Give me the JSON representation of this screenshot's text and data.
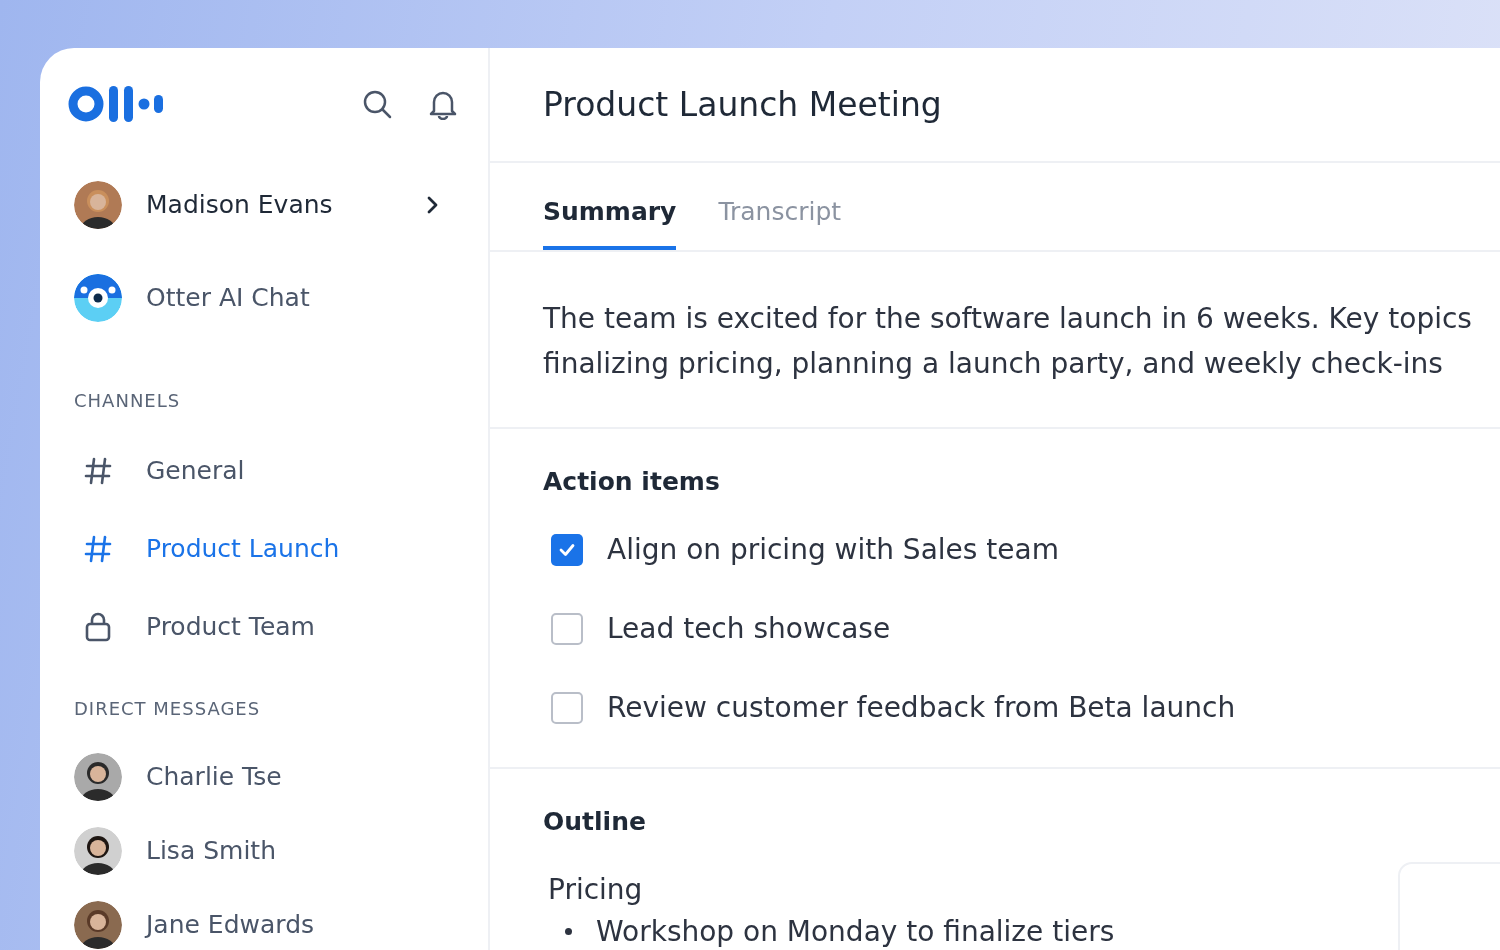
{
  "user": {
    "name": "Madison Evans"
  },
  "ai_chat": {
    "label": "Otter AI Chat"
  },
  "channels": {
    "heading": "CHANNELS",
    "items": [
      {
        "label": "General",
        "kind": "public",
        "selected": false
      },
      {
        "label": "Product Launch",
        "kind": "public",
        "selected": true
      },
      {
        "label": "Product Team",
        "kind": "private",
        "selected": false
      }
    ]
  },
  "direct_messages": {
    "heading": "DIRECT MESSAGES",
    "items": [
      {
        "name": "Charlie Tse"
      },
      {
        "name": "Lisa Smith"
      },
      {
        "name": "Jane Edwards"
      }
    ]
  },
  "meeting": {
    "title": "Product Launch Meeting",
    "tabs": [
      {
        "label": "Summary",
        "selected": true
      },
      {
        "label": "Transcript",
        "selected": false
      }
    ],
    "summary": [
      "The team is excited for the software launch in 6 weeks. Key topics",
      "finalizing pricing, planning a launch party, and weekly check-ins"
    ],
    "action_items": {
      "heading": "Action items",
      "items": [
        {
          "label": "Align on pricing with Sales team",
          "checked": true
        },
        {
          "label": "Lead tech showcase",
          "checked": false
        },
        {
          "label": "Review customer feedback from Beta launch",
          "checked": false
        }
      ]
    },
    "outline": {
      "heading": "Outline",
      "sections": [
        {
          "title": "Pricing",
          "bullets": [
            "Workshop on Monday to finalize tiers"
          ]
        }
      ]
    }
  }
}
